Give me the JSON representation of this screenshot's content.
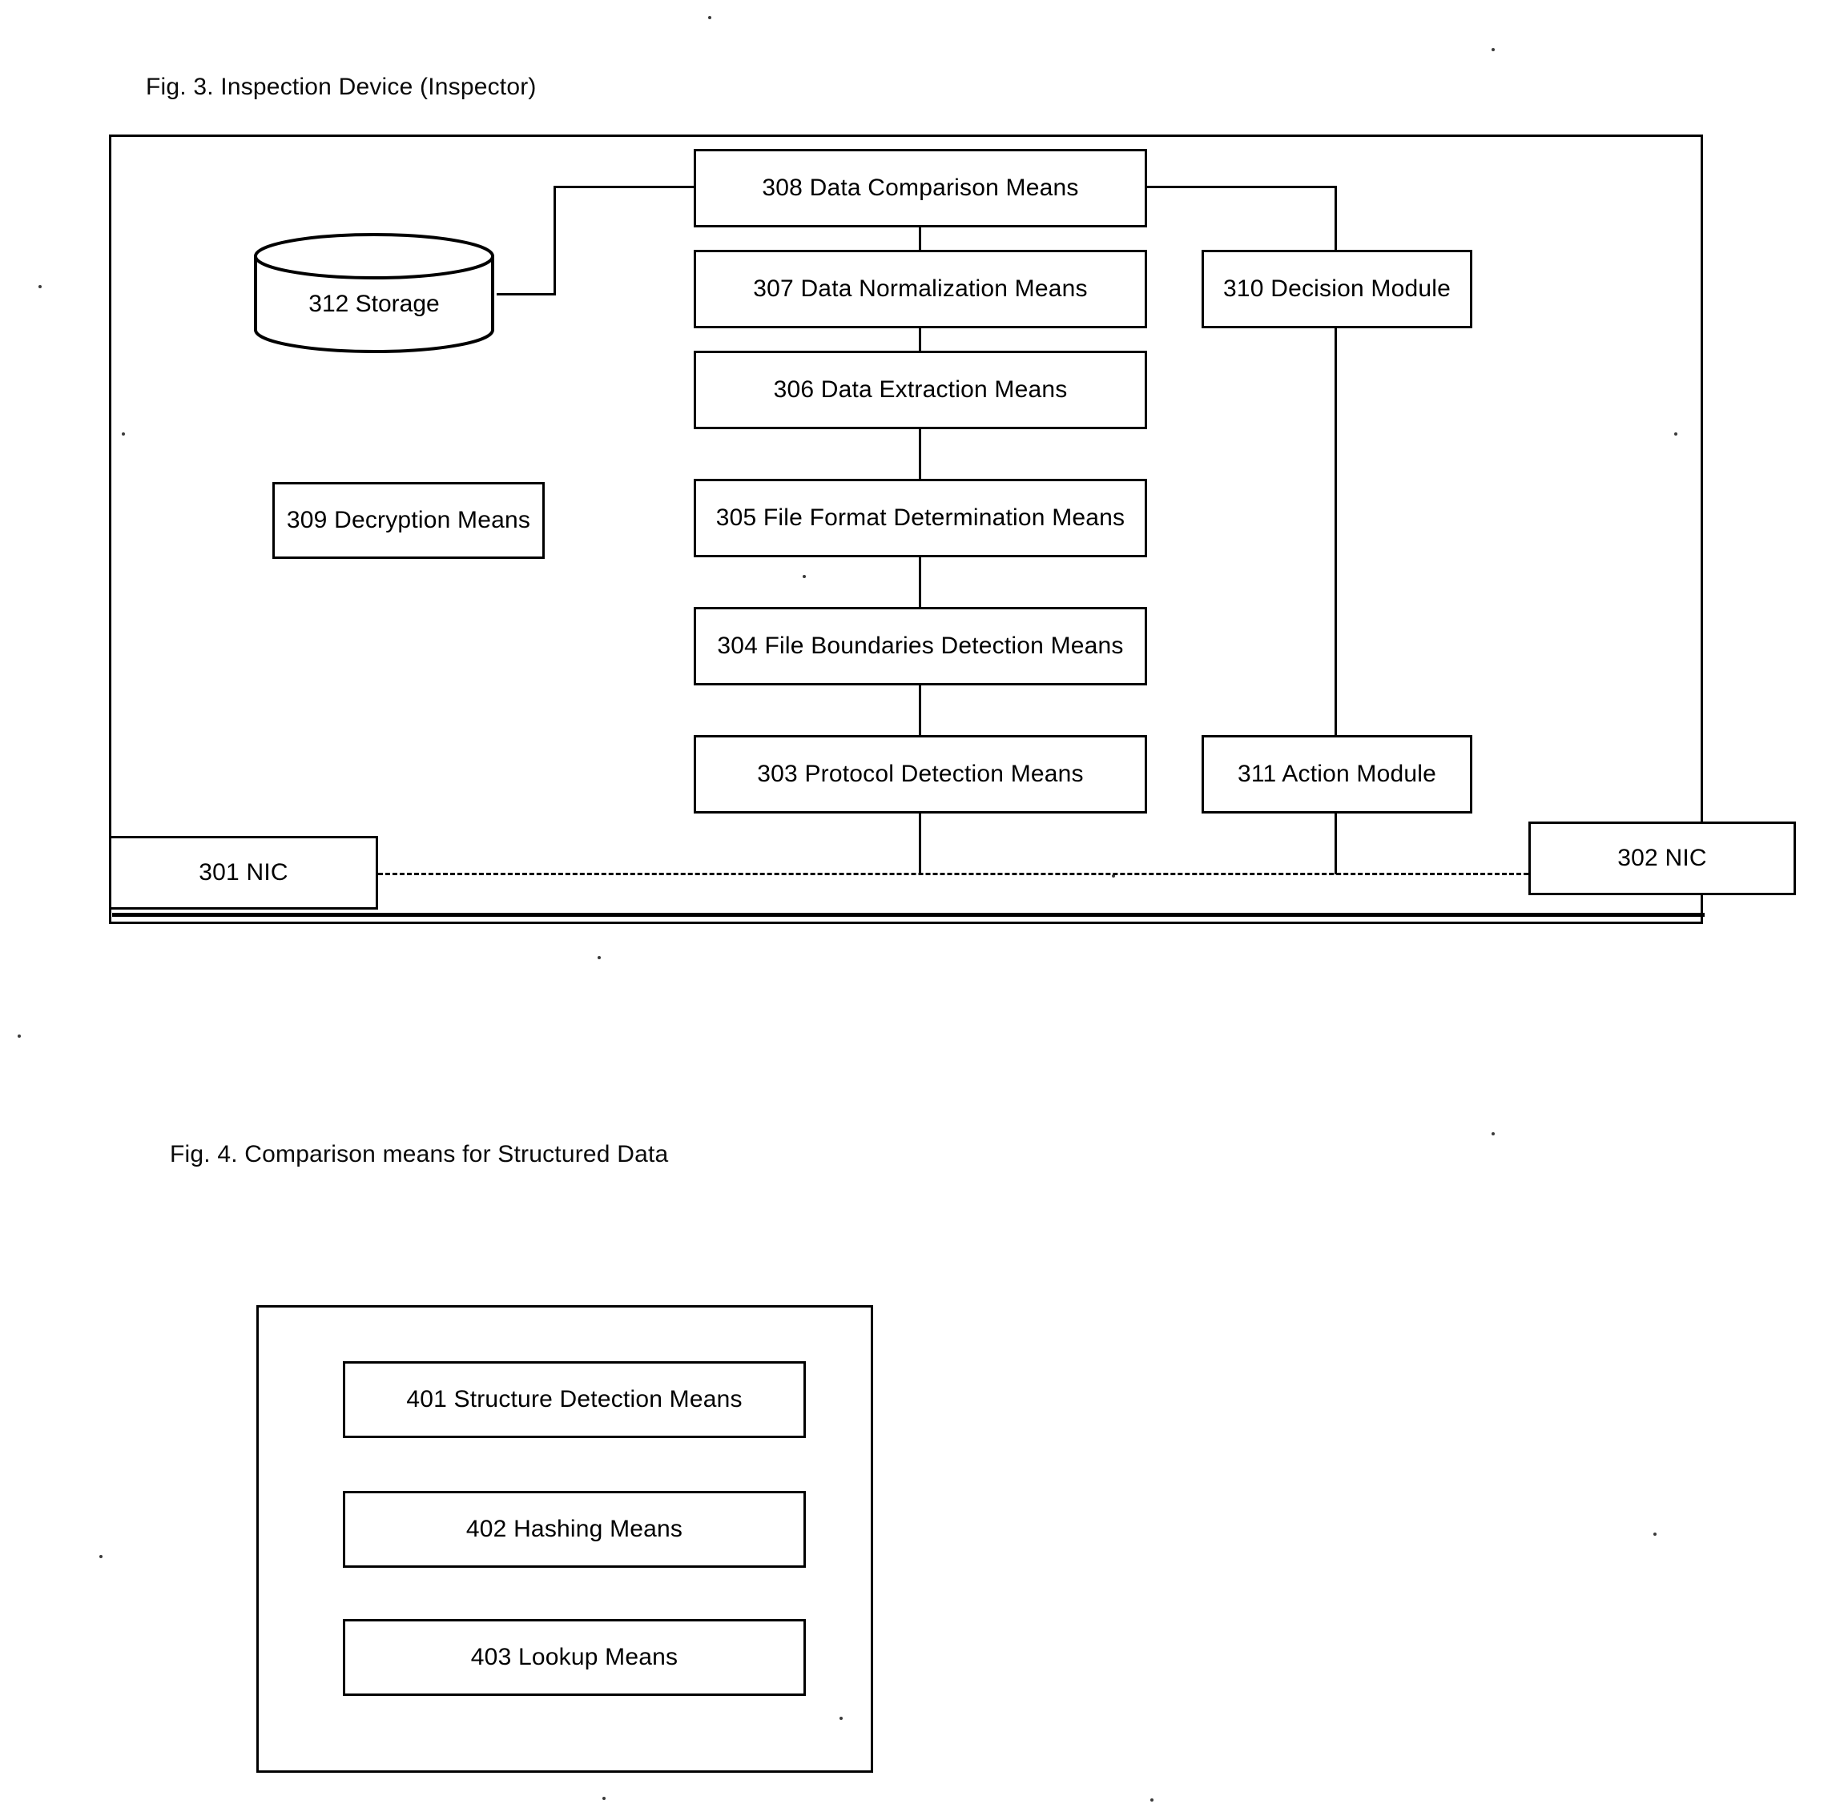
{
  "figures": [
    {
      "id": "fig3",
      "caption": "Fig. 3.  Inspection Device (Inspector)",
      "boxes": {
        "b308": "308 Data Comparison Means",
        "b307": "307 Data Normalization Means",
        "b306": "306 Data Extraction Means",
        "b305": "305 File Format Determination Means",
        "b304": "304 File Boundaries Detection Means",
        "b303": "303 Protocol Detection Means",
        "b309": "309 Decryption Means",
        "b310": "310 Decision Module",
        "b311": "311 Action Module",
        "b301": "301 NIC",
        "b302": "302 NIC",
        "b312": "312 Storage"
      }
    },
    {
      "id": "fig4",
      "caption": "Fig. 4. Comparison means for Structured Data",
      "boxes": {
        "b401": "401 Structure Detection Means",
        "b402": "402 Hashing Means",
        "b403": "403 Lookup Means"
      }
    }
  ],
  "fig3": {
    "caption": "Fig. 3.  Inspection Device (Inspector)",
    "box_308": "308 Data Comparison Means",
    "box_307": "307 Data Normalization Means",
    "box_306": "306 Data Extraction Means",
    "box_305": "305 File Format Determination Means",
    "box_304": "304 File Boundaries Detection Means",
    "box_303": "303 Protocol Detection Means",
    "box_309": "309 Decryption Means",
    "box_310": "310 Decision Module",
    "box_311": "311 Action Module",
    "box_301": "301 NIC",
    "box_302": "302 NIC",
    "storage_312": "312 Storage"
  },
  "fig4": {
    "caption": "Fig. 4. Comparison means for Structured Data",
    "box_401": "401 Structure Detection Means",
    "box_402": "402 Hashing Means",
    "box_403": "403 Lookup Means"
  },
  "colors": {
    "ink": "#000000",
    "paper": "#ffffff"
  }
}
